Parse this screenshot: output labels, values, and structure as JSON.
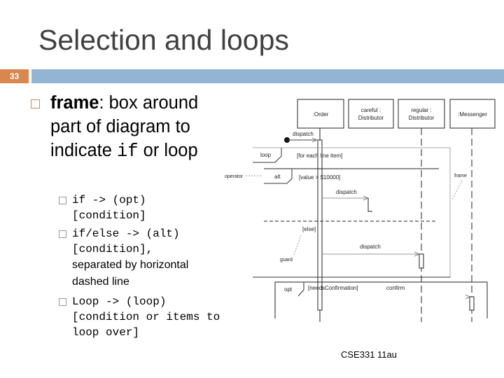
{
  "slide": {
    "title": "Selection and loops",
    "number": "33",
    "bullet": {
      "bold": "frame",
      "text_1": ": box around part of diagram to indicate ",
      "code": "if",
      "text_2": " or loop"
    },
    "sub_bullets": [
      {
        "code": "if  -> (opt) [condition]",
        "text": ""
      },
      {
        "code": "if/else -> (alt) [condition],",
        "text": "separated by horizontal dashed line"
      },
      {
        "code": "Loop -> (loop) [condition or items to loop over]",
        "text": ""
      }
    ],
    "footer": "CSE331 11au",
    "colors": {
      "number_bg": "#d9874f",
      "bar": "#94b4d3"
    }
  },
  "diagram": {
    "objects": [
      ":Order",
      "careful :",
      "Distributor",
      "regular :",
      "Distributor",
      ":Messenger"
    ],
    "messages": {
      "dispatch_start": "dispatch",
      "dispatch_alt": "dispatch",
      "dispatch_else": "dispatch",
      "confirm": "confirm"
    },
    "frames": {
      "loop": "loop",
      "loop_guard": "[for each line item]",
      "alt": "alt",
      "alt_guard": "[value > $10000]",
      "else_guard": "[else]",
      "opt": "opt",
      "opt_guard": "[needsConfirmation]"
    },
    "annotations": {
      "operator": "operator",
      "frame": "frame",
      "guard": "guard"
    }
  }
}
